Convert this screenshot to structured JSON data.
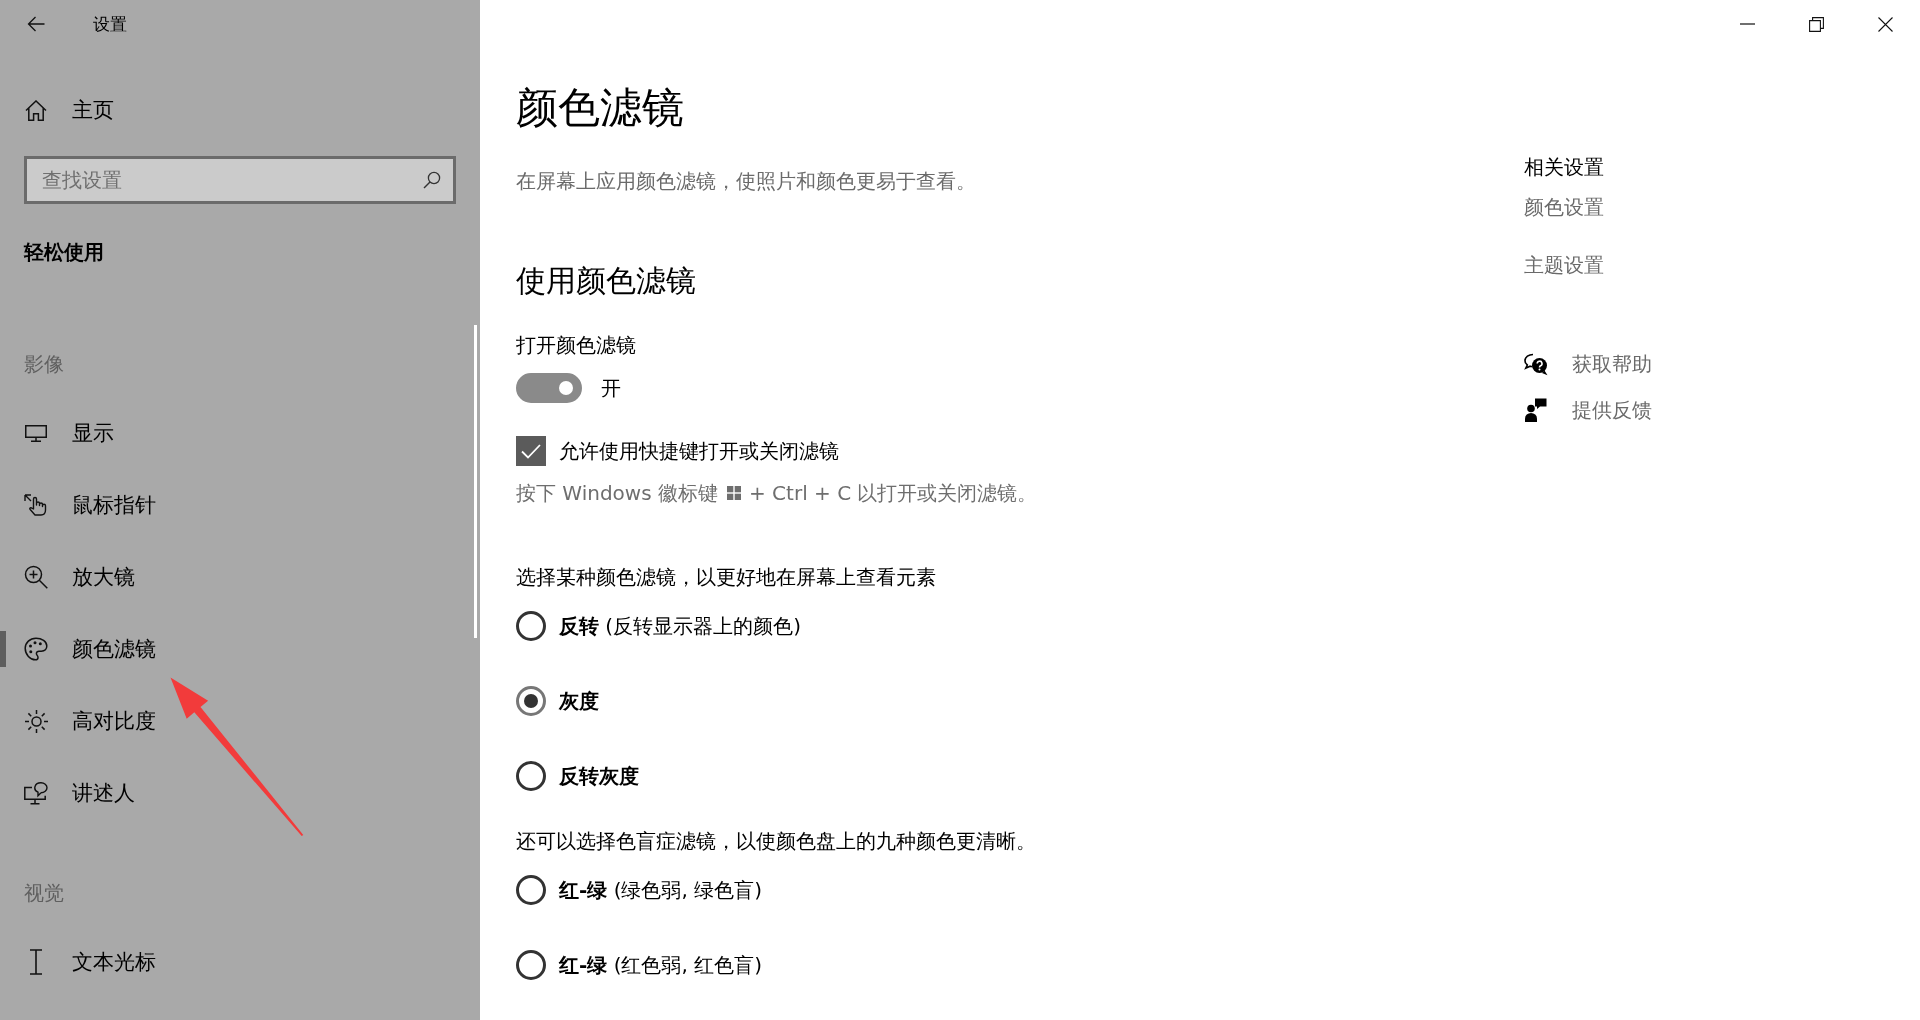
{
  "sidebar": {
    "title": "设置",
    "home": "主页",
    "search": {
      "placeholder": "查找设置"
    },
    "section_title": "轻松使用",
    "groups": [
      {
        "label": "影像",
        "items": [
          {
            "label": "显示",
            "selected": false
          },
          {
            "label": "鼠标指针",
            "selected": false
          },
          {
            "label": "放大镜",
            "selected": false
          },
          {
            "label": "颜色滤镜",
            "selected": true
          },
          {
            "label": "高对比度",
            "selected": false
          },
          {
            "label": "讲述人",
            "selected": false
          }
        ]
      },
      {
        "label": "视觉",
        "items": [
          {
            "label": "文本光标",
            "selected": false
          }
        ]
      }
    ]
  },
  "page": {
    "title": "颜色滤镜",
    "description": "在屏幕上应用颜色滤镜，使照片和颜色更易于查看。",
    "section_title": "使用颜色滤镜",
    "toggle": {
      "label": "打开颜色滤镜",
      "on": true,
      "state_text": "开"
    },
    "shortcut": {
      "label": "允许使用快捷键打开或关闭滤镜",
      "checked": true
    },
    "shortcut_hint": {
      "before": "按下 Windows 徽标键",
      "after": "+ Ctrl + C 以打开或关闭滤镜。"
    },
    "filter_prompt": "选择某种颜色滤镜，以更好地在屏幕上查看元素",
    "filters": [
      {
        "label": "反转",
        "detail": "(反转显示器上的颜色)",
        "selected": false
      },
      {
        "label": "灰度",
        "selected": true
      },
      {
        "label": "反转灰度",
        "selected": false
      }
    ],
    "colorblind_prompt": "还可以选择色盲症滤镜，以使颜色盘上的九种颜色更清晰。",
    "colorblind_filters": [
      {
        "label": "红-绿",
        "detail": "(绿色弱, 绿色盲)",
        "selected": false
      },
      {
        "label": "红-绿",
        "detail": "(红色弱, 红色盲)",
        "selected": false
      }
    ]
  },
  "related": {
    "title": "相关设置",
    "links": [
      "颜色设置",
      "主题设置"
    ]
  },
  "support": [
    "获取帮助",
    "提供反馈"
  ]
}
